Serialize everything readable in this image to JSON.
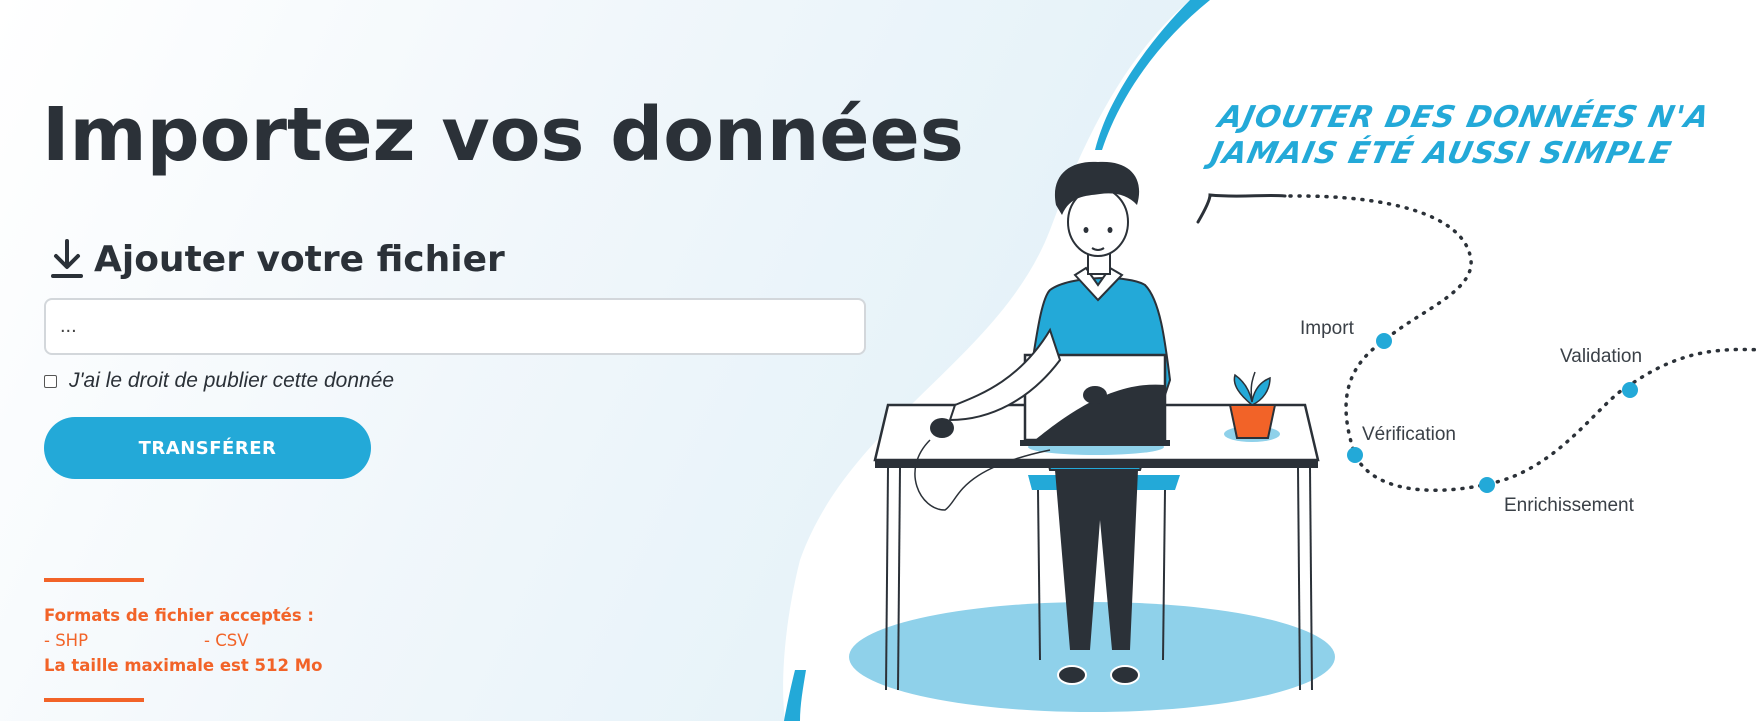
{
  "hero": {
    "title": "Importez vos données"
  },
  "upload": {
    "section_label": "Ajouter votre fichier",
    "icon": "download-icon",
    "file_value": "...",
    "consent_label": "J'ai le droit de publier cette donnée",
    "consent_checked": false,
    "submit_label": "TRANSFÉRER"
  },
  "info": {
    "formats_title": "Formats de fichier acceptés :",
    "formats": [
      "- SHP",
      "- CSV"
    ],
    "max_size": "La taille maximale est 512 Mo"
  },
  "illustration": {
    "tagline_line1": "Ajouter des données n'a",
    "tagline_line2": "jamais été aussi simple",
    "steps": [
      "Import",
      "Vérification",
      "Enrichissement",
      "Validation"
    ]
  },
  "colors": {
    "accent_blue": "#23a9d8",
    "accent_orange": "#f26328",
    "text_dark": "#2b3138"
  }
}
